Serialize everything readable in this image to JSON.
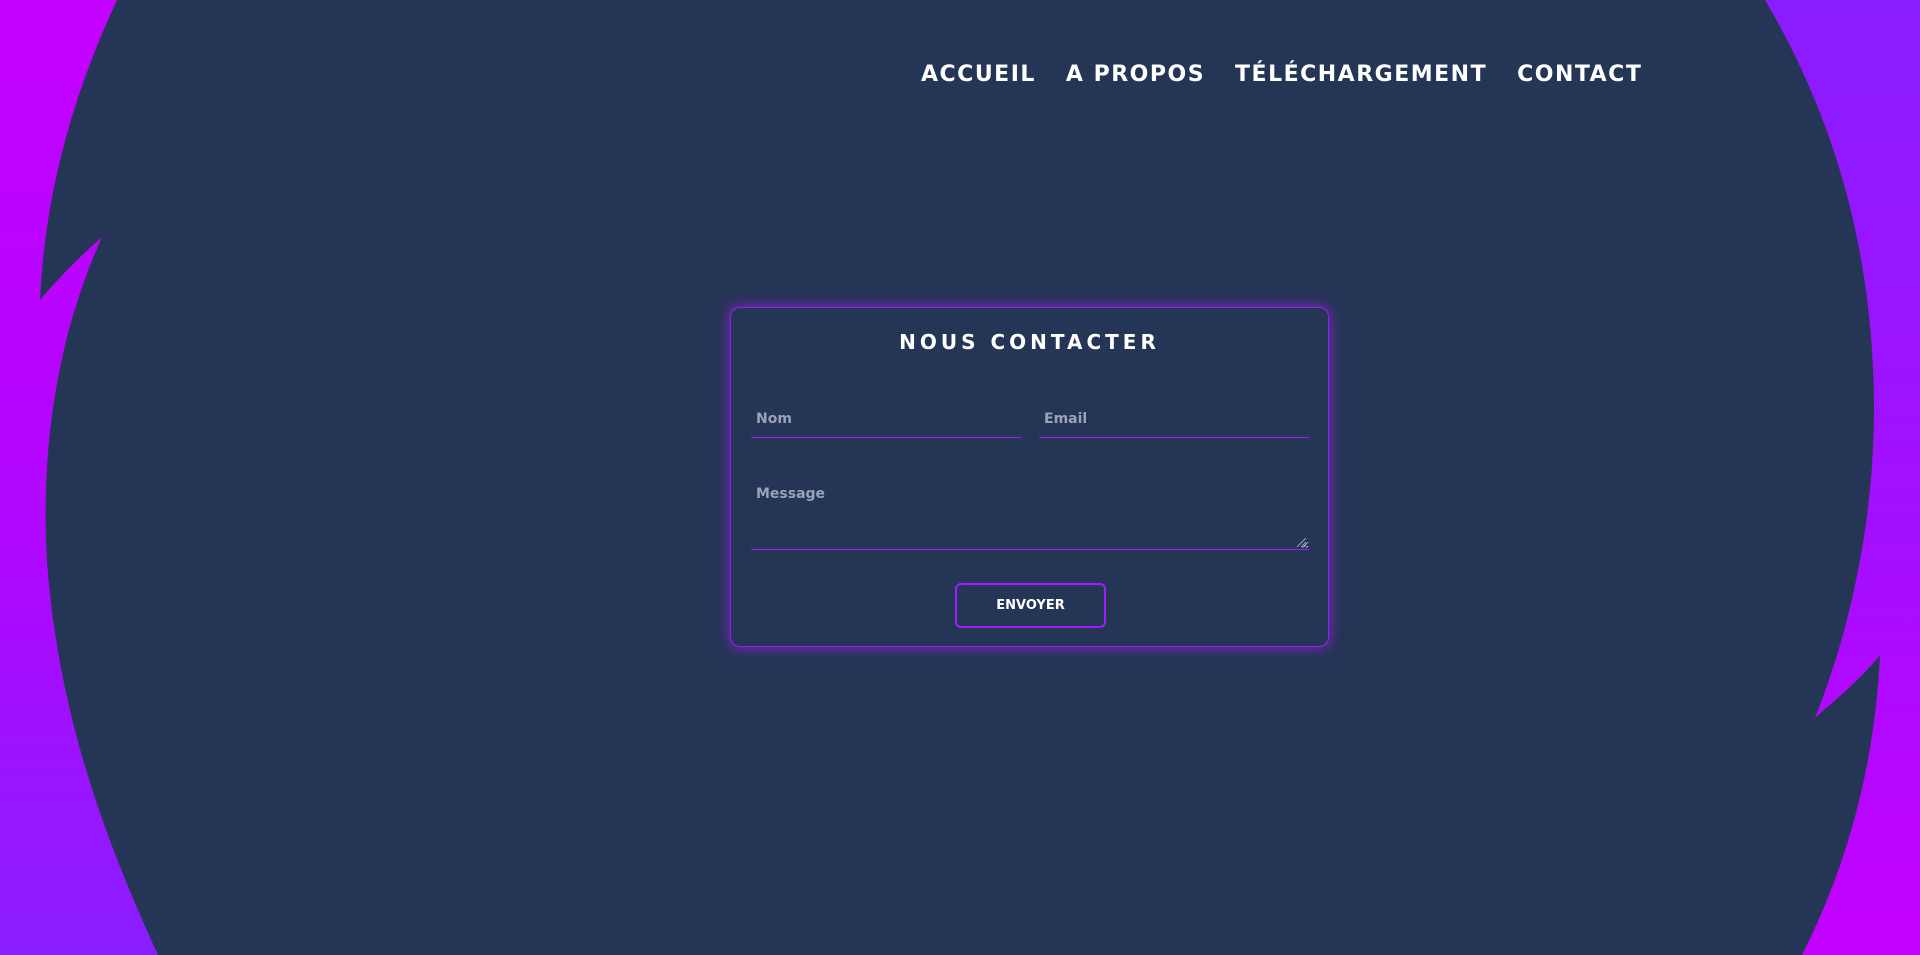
{
  "nav": {
    "items": [
      {
        "label": "ACCUEIL"
      },
      {
        "label": "A PROPOS"
      },
      {
        "label": "TÉLÉCHARGEMENT"
      },
      {
        "label": "CONTACT"
      }
    ]
  },
  "contact_form": {
    "title": "NOUS CONTACTER",
    "name_placeholder": "Nom",
    "name_value": "",
    "email_placeholder": "Email",
    "email_value": "",
    "message_placeholder": "Message",
    "message_value": "",
    "submit_label": "ENVOYER"
  },
  "colors": {
    "background": "#253555",
    "accent": "#a21cff",
    "shape_magenta": "#c400ff",
    "shape_violet": "#8a1dff",
    "text": "#ffffff",
    "placeholder": "#9aa3b8"
  },
  "icons": {
    "resize_handle": "textarea-resize-grip-icon"
  }
}
